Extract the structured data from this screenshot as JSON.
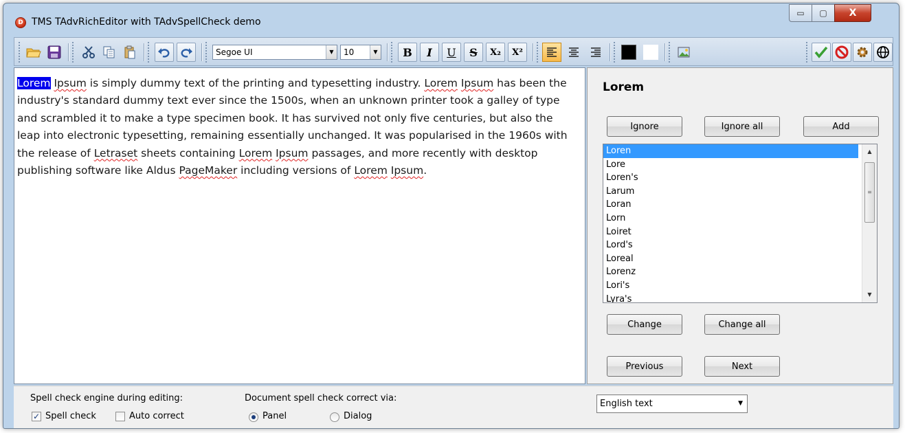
{
  "window": {
    "title": "TMS TAdvRichEditor with TAdvSpellCheck demo",
    "app_icon_letter": "D",
    "minimize_glyph": "▭",
    "maximize_glyph": "▢",
    "close_glyph": "X"
  },
  "toolbar": {
    "font_name": "Segoe UI",
    "font_size": "10",
    "combo_arrow": "▼",
    "bold_label": "B",
    "italic_label": "I",
    "underline_label": "U",
    "strike_label": "S",
    "subscript_label": "X₂",
    "superscript_label": "X²",
    "text_color": "#000000",
    "back_color": "#ffffff"
  },
  "editor": {
    "selected_word": "Lorem",
    "segments": [
      {
        "text": " "
      },
      {
        "text": "Ipsum",
        "misspelled": true
      },
      {
        "text": " is simply dummy text of the printing and typesetting industry. "
      },
      {
        "text": "Lorem",
        "misspelled": true
      },
      {
        "text": " "
      },
      {
        "text": "Ipsum",
        "misspelled": true
      },
      {
        "text": " has been the industry's standard dummy text ever since the 1500s, when an unknown printer took a galley of type and scrambled it to make a type specimen book. It has survived not only five centuries, but also the leap into electronic typesetting, remaining essentially unchanged. It was popularised in the 1960s with the release of "
      },
      {
        "text": "Letraset",
        "misspelled": true
      },
      {
        "text": " sheets containing "
      },
      {
        "text": "Lorem",
        "misspelled": true
      },
      {
        "text": " "
      },
      {
        "text": "Ipsum",
        "misspelled": true
      },
      {
        "text": " passages, and more recently with desktop publishing software like Aldus "
      },
      {
        "text": "PageMaker",
        "misspelled": true
      },
      {
        "text": " including versions of "
      },
      {
        "text": "Lorem",
        "misspelled": true
      },
      {
        "text": " "
      },
      {
        "text": "Ipsum",
        "misspelled": true
      },
      {
        "text": "."
      }
    ]
  },
  "panel": {
    "word": "Lorem",
    "ignore": "Ignore",
    "ignore_all": "Ignore all",
    "add": "Add",
    "suggestions": [
      "Loren",
      "Lore",
      "Loren's",
      "Larum",
      "Loran",
      "Lorn",
      "Loiret",
      "Lord's",
      "Loreal",
      "Lorenz",
      "Lori's",
      "Lyra's"
    ],
    "selected_index": 0,
    "change": "Change",
    "change_all": "Change all",
    "previous": "Previous",
    "next": "Next"
  },
  "bottom": {
    "engine_label": "Spell check engine during editing:",
    "spell_check": "Spell check",
    "spell_check_checked": true,
    "auto_correct": "Auto correct",
    "auto_correct_checked": false,
    "correct_via_label": "Document spell check correct via:",
    "panel_option": "Panel",
    "dialog_option": "Dialog",
    "selected_option": "Panel",
    "language": "English text"
  },
  "colors": {
    "selection": "#0000ee",
    "list_selection": "#3399ff",
    "misspell_underline": "#e02020",
    "window_frame": "#bcd3ea"
  }
}
